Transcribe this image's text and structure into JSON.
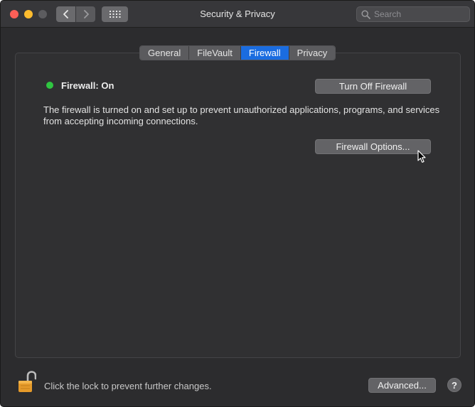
{
  "window": {
    "title": "Security & Privacy",
    "search_placeholder": "Search"
  },
  "tabs": [
    {
      "label": "General",
      "active": false
    },
    {
      "label": "FileVault",
      "active": false
    },
    {
      "label": "Firewall",
      "active": true
    },
    {
      "label": "Privacy",
      "active": false
    }
  ],
  "firewall": {
    "status_label": "Firewall: On",
    "status_color": "#2fc541",
    "toggle_button_label": "Turn Off Firewall",
    "description": "The firewall is turned on and set up to prevent unauthorized applications, programs, and services from accepting incoming connections.",
    "options_button_label": "Firewall Options..."
  },
  "footer": {
    "lock_text": "Click the lock to prevent further changes.",
    "advanced_button_label": "Advanced...",
    "help_label": "?"
  },
  "icons": {
    "close": "close-icon",
    "minimize": "minimize-icon",
    "zoom": "zoom-icon",
    "back": "chevron-left-icon",
    "forward": "chevron-right-icon",
    "show_all": "grid-icon",
    "search": "search-icon",
    "lock": "unlocked-padlock-icon",
    "cursor": "arrow-cursor-icon"
  },
  "colors": {
    "accent": "#1a6ce0",
    "status_on": "#2fc541"
  }
}
